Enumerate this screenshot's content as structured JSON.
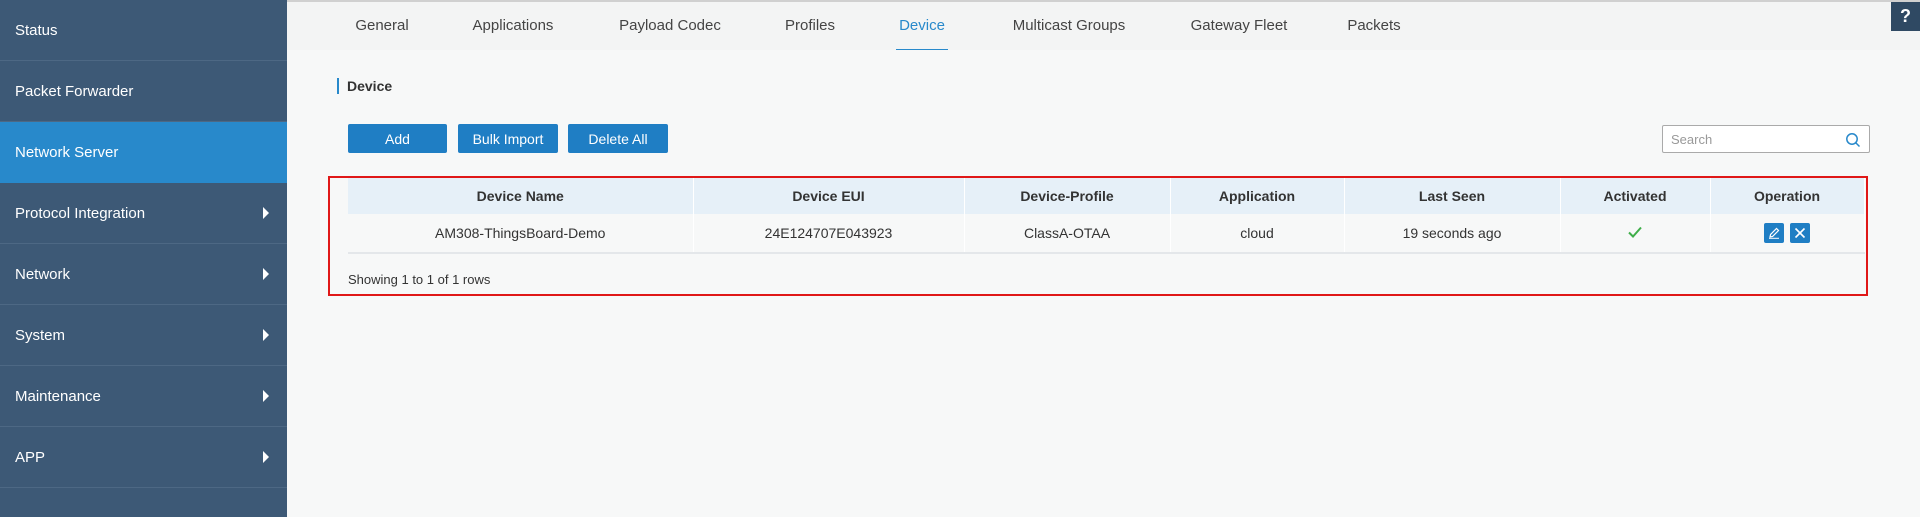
{
  "sidebar": {
    "items": [
      {
        "label": "Status",
        "has_arrow": false,
        "active": false
      },
      {
        "label": "Packet Forwarder",
        "has_arrow": false,
        "active": false
      },
      {
        "label": "Network Server",
        "has_arrow": false,
        "active": true
      },
      {
        "label": "Protocol Integration",
        "has_arrow": true,
        "active": false
      },
      {
        "label": "Network",
        "has_arrow": true,
        "active": false
      },
      {
        "label": "System",
        "has_arrow": true,
        "active": false
      },
      {
        "label": "Maintenance",
        "has_arrow": true,
        "active": false
      },
      {
        "label": "APP",
        "has_arrow": true,
        "active": false
      }
    ]
  },
  "tabs": [
    {
      "label": "General"
    },
    {
      "label": "Applications"
    },
    {
      "label": "Payload Codec"
    },
    {
      "label": "Profiles"
    },
    {
      "label": "Device"
    },
    {
      "label": "Multicast Groups"
    },
    {
      "label": "Gateway Fleet"
    },
    {
      "label": "Packets"
    }
  ],
  "active_tab": "Device",
  "help_label": "?",
  "section": {
    "title": "Device"
  },
  "toolbar": {
    "add_label": "Add",
    "bulk_import_label": "Bulk Import",
    "delete_all_label": "Delete All"
  },
  "search": {
    "placeholder": "Search",
    "value": ""
  },
  "table": {
    "columns": [
      "Device Name",
      "Device EUI",
      "Device-Profile",
      "Application",
      "Last Seen",
      "Activated",
      "Operation"
    ],
    "rows": [
      {
        "device_name": "AM308-ThingsBoard-Demo",
        "device_eui": "24E124707E043923",
        "device_profile": "ClassA-OTAA",
        "application": "cloud",
        "last_seen": "19 seconds ago",
        "activated_icon": "check-icon",
        "operations": [
          "edit-icon",
          "delete-icon"
        ]
      }
    ],
    "footer": "Showing 1 to 1 of 1 rows"
  },
  "colors": {
    "sidebar_bg": "#3d5976",
    "sidebar_active": "#2889cb",
    "button_bg": "#1f7ec4",
    "highlight_frame": "#e01818",
    "check": "#3fae49"
  }
}
